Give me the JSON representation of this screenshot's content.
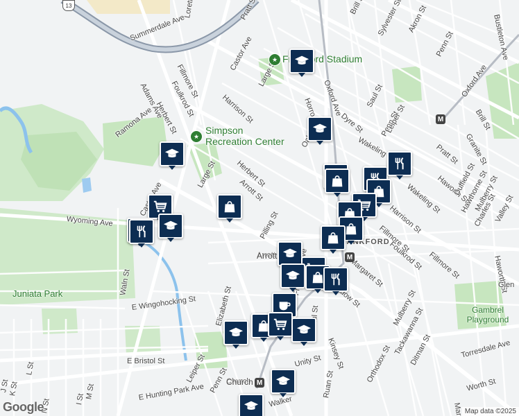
{
  "map": {
    "attribution": "Map data ©2025",
    "logo": "Google",
    "route_shield": "13"
  },
  "places": [
    {
      "name": "Frankford Stadium",
      "color": "#2e7d32"
    },
    {
      "name": "Simpson Recreation Center",
      "color": "#2e7d32"
    }
  ],
  "parks": [
    "Juniata Park",
    "Gambrel Playground"
  ],
  "neighborhood": "FRANKFORD",
  "streets": [
    "Summerdale Ave",
    "Loretto Ave",
    "Pratt St",
    "Brill St",
    "Akron St",
    "Sylvester St",
    "Bustleton Ave",
    "Penn St",
    "Castor Ave",
    "Fillmore St",
    "Foulkrod St",
    "Harrison St",
    "Large St",
    "Horrocks St",
    "Oxford Ave",
    "Dyre St",
    "Saul St",
    "Adams Ave",
    "Herbert St",
    "Ramona Ave",
    "Oak",
    "Wakeling St",
    "Penn St",
    "Leiper St",
    "Pratt St",
    "Granite St",
    "Oxford Ave",
    "Brill St",
    "Herbert St",
    "Arrott St",
    "Large St",
    "Castor Ave",
    "Haworth St",
    "Duffield St",
    "Hawthorne St",
    "Mulberry St",
    "Wakeling St",
    "Wyoming Ave",
    "Harrison St",
    "Fillmore St",
    "Foulkrod St",
    "Charles St",
    "Valley St",
    "Pilling St",
    "Arrott St",
    "Margaret St",
    "Fillmore St",
    "Haworth St",
    "E Wingohocking St",
    "Elizabeth St",
    "Frankford Ave",
    "Meadow St",
    "Glen",
    "Mulberry St",
    "Tackawanna St",
    "Kinsey St",
    "Paul St",
    "Orthodox St",
    "Ditman St",
    "Torresdale Ave",
    "E Bristol St",
    "Unity St",
    "Leiper St",
    "Penn St",
    "Church",
    "Margaret",
    "Worth St",
    "E Hunting Park Ave",
    "L St",
    "K St",
    "J St",
    "I St",
    "M St",
    "N St",
    "Walker",
    "Ruan St",
    "Waln St",
    "Castor Ave"
  ],
  "stations": [
    {
      "label": "Church"
    },
    {
      "label": "Arrott"
    }
  ],
  "markers": [
    {
      "type": "school",
      "icon": "graduation-cap-icon"
    },
    {
      "type": "school",
      "icon": "graduation-cap-icon"
    },
    {
      "type": "grocery",
      "icon": "shopping-cart-icon"
    },
    {
      "type": "school",
      "icon": "graduation-cap-icon"
    },
    {
      "type": "school",
      "icon": "graduation-cap-icon"
    },
    {
      "type": "grocery",
      "icon": "shopping-cart-icon"
    },
    {
      "type": "restaurant",
      "icon": "fork-knife-icon"
    },
    {
      "type": "school",
      "icon": "graduation-cap-icon"
    },
    {
      "type": "shopping",
      "icon": "shopping-bag-icon"
    },
    {
      "type": "shopping",
      "icon": "shopping-bag-icon"
    },
    {
      "type": "restaurant",
      "icon": "fork-knife-icon"
    },
    {
      "type": "restaurant",
      "icon": "fork-knife-icon"
    },
    {
      "type": "shopping",
      "icon": "shopping-bag-icon"
    },
    {
      "type": "grocery",
      "icon": "shopping-cart-icon"
    },
    {
      "type": "shopping",
      "icon": "shopping-bag-icon"
    },
    {
      "type": "shopping",
      "icon": "shopping-bag-icon"
    },
    {
      "type": "shopping",
      "icon": "shopping-bag-icon"
    },
    {
      "type": "school",
      "icon": "graduation-cap-icon"
    },
    {
      "type": "grocery",
      "icon": "shopping-cart-icon"
    },
    {
      "type": "school",
      "icon": "graduation-cap-icon"
    },
    {
      "type": "shopping",
      "icon": "shopping-bag-icon"
    },
    {
      "type": "restaurant",
      "icon": "fork-knife-icon"
    },
    {
      "type": "cafe",
      "icon": "coffee-cup-icon"
    },
    {
      "type": "school",
      "icon": "graduation-cap-icon"
    },
    {
      "type": "shopping",
      "icon": "shopping-bag-icon"
    },
    {
      "type": "grocery",
      "icon": "shopping-cart-icon"
    },
    {
      "type": "school",
      "icon": "graduation-cap-icon"
    },
    {
      "type": "school",
      "icon": "graduation-cap-icon"
    },
    {
      "type": "school",
      "icon": "graduation-cap-icon"
    }
  ]
}
